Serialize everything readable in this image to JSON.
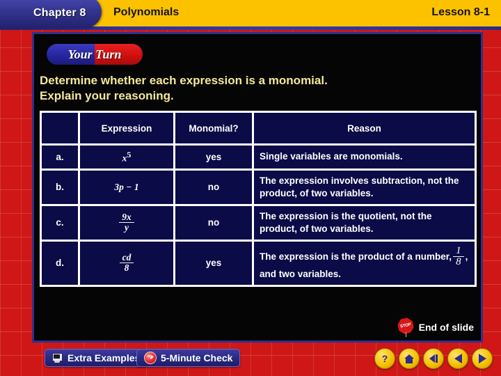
{
  "header": {
    "chapter_tab": "Chapter 8",
    "subject": "Polynomials",
    "lesson": "Lesson 8-1"
  },
  "badge": {
    "label": "Your Turn"
  },
  "instruction": {
    "line1": "Determine whether each expression is a monomial.",
    "line2": "Explain your reasoning."
  },
  "table": {
    "headers": {
      "blank": "",
      "expression": "Expression",
      "monomial": "Monomial?",
      "reason": "Reason"
    },
    "rows": [
      {
        "label": "a.",
        "expression_text": "x^5",
        "expression_base": "x",
        "expression_exp": "5",
        "monomial": "yes",
        "reason": "Single variables are monomials."
      },
      {
        "label": "b.",
        "expression_text": "3p − 1",
        "monomial": "no",
        "reason": "The expression involves subtraction, not the product, of two variables."
      },
      {
        "label": "c.",
        "expression_text": "9x/y",
        "expression_num": "9x",
        "expression_den": "y",
        "monomial": "no",
        "reason": "The expression is the quotient, not the product, of two variables."
      },
      {
        "label": "d.",
        "expression_text": "cd/8",
        "expression_num": "cd",
        "expression_den": "8",
        "monomial": "yes",
        "reason_part1": "The expression is the product of a number,",
        "reason_frac_num": "1",
        "reason_frac_den": "8",
        "reason_part2": ", and two variables."
      }
    ]
  },
  "end_of_slide": {
    "label": "End of slide",
    "stop_text": "STOP"
  },
  "toolbar": {
    "extra_examples": "Extra Examples",
    "five_minute_check": "5-Minute Check",
    "help_glyph": "?",
    "nav_names": [
      "help",
      "home",
      "rewind",
      "previous",
      "next"
    ]
  },
  "colors": {
    "frame_red": "#cf1717",
    "header_yellow": "#fcc200",
    "tab_blue": "#2b2b86",
    "cell_navy": "#0b0b47",
    "accent_yellow_text": "#f2e89a",
    "nav_button_yellow": "#f5c200"
  }
}
